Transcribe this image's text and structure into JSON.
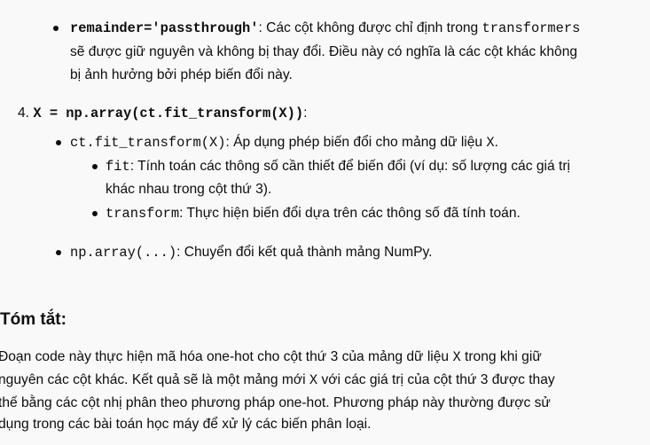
{
  "bullet_remainder": {
    "code": "remainder='passthrough'",
    "lines": [
      ": Các cột không được chỉ định trong ",
      "sẽ được giữ nguyên và không bị thay đổi. Điều này có nghĩa là các cột khác không",
      "bị ảnh hưởng bởi phép biến đổi này."
    ],
    "code_inline": "transformers"
  },
  "step4": {
    "number": "4.",
    "code": "X = np.array(ct.fit_transform(X))",
    "suffix": ":"
  },
  "bullet_fit_transform": {
    "code": "ct.fit_transform(X)",
    "text": ": Áp dụng phép biến đổi cho mảng dữ liệu ",
    "code_end": "X",
    "end": "."
  },
  "sub_fit": {
    "code": "fit",
    "line1": ": Tính toán các thông số cần thiết để biến đổi (ví dụ: số lượng các giá trị",
    "line2": "khác nhau trong cột thứ 3)."
  },
  "sub_transform": {
    "code": "transform",
    "text": ": Thực hiện biến đổi dựa trên các thông số đã tính toán."
  },
  "bullet_nparray": {
    "code": "np.array(...)",
    "text": ": Chuyển đổi kết quả thành mảng NumPy."
  },
  "summary": {
    "heading": "Tóm tắt:",
    "l1a": "Đoạn code này thực hiện mã hóa one-hot cho cột thứ 3 của mảng dữ liệu ",
    "l1code": "X",
    "l1b": " trong khi giữ",
    "l2a": "nguyên các cột khác. Kết quả sẽ là một mảng mới ",
    "l2code": "X",
    "l2b": " với các giá trị của cột thứ 3 được thay",
    "l3": "thế bằng các cột nhị phân theo phương pháp one-hot. Phương pháp này thường được sử",
    "l4": "dụng trong các bài toán học máy để xử lý các biến phân loại."
  }
}
